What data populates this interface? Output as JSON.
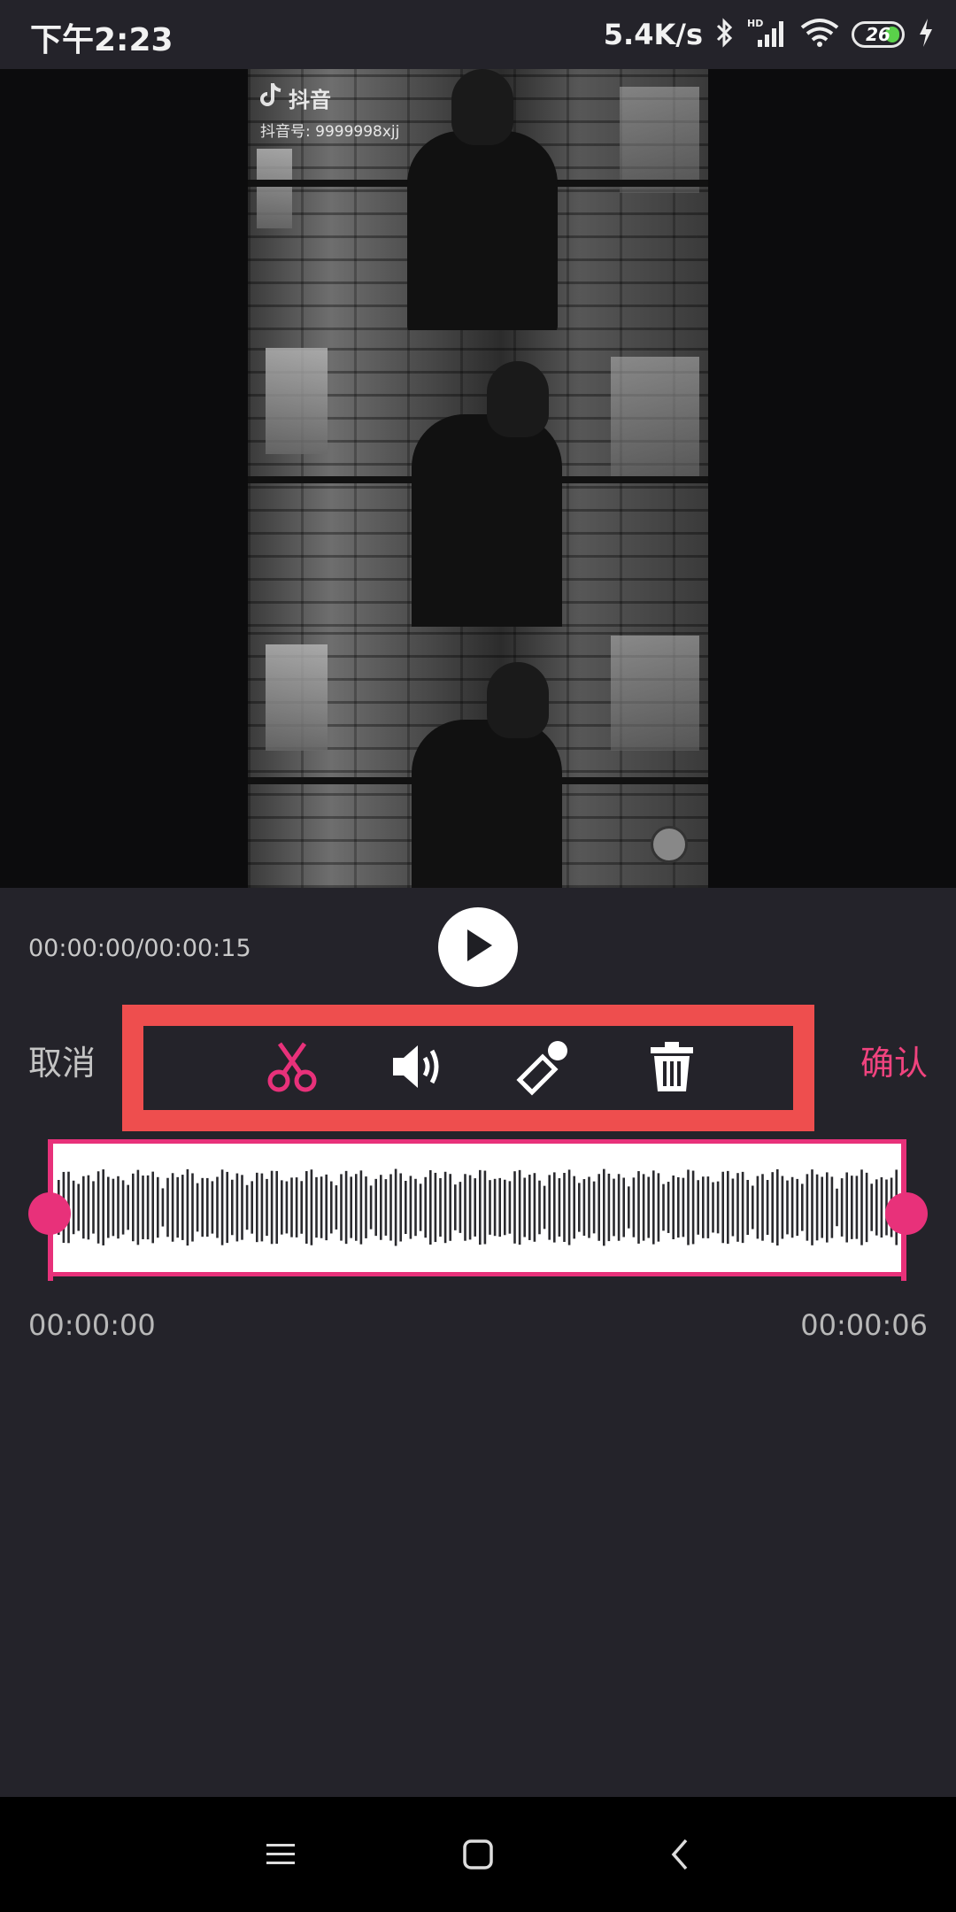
{
  "status_bar": {
    "time": "下午2:23",
    "net_speed": "5.4K/s",
    "battery_percent": "26",
    "icons": [
      "bluetooth-icon",
      "hd-signal-icon",
      "wifi-icon",
      "battery-icon",
      "charging-icon"
    ]
  },
  "video": {
    "watermark_title": "抖音",
    "watermark_id": "抖音号: 9999998xjj"
  },
  "player": {
    "time": "00:00:00/00:00:15",
    "play_icon": "play-icon"
  },
  "toolbar": {
    "cancel_label": "取消",
    "confirm_label": "确认",
    "tools": [
      "scissors-icon",
      "volume-icon",
      "magic-wand-icon",
      "trash-icon"
    ],
    "accent": "#e8317a",
    "highlight": "#ee4e4e"
  },
  "timeline": {
    "start_time": "00:00:00",
    "end_time": "00:00:06"
  },
  "nav": {
    "icons": [
      "menu-icon",
      "home-icon",
      "back-icon"
    ]
  }
}
